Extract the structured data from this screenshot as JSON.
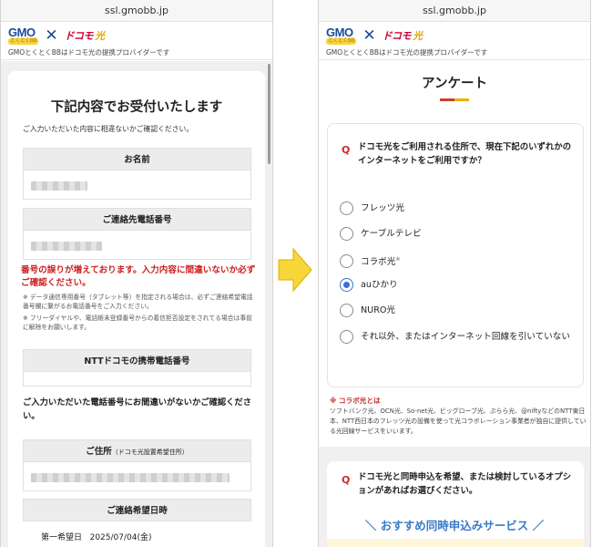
{
  "left": {
    "url": "ssl.gmobb.jp",
    "header": {
      "brand": "GMO",
      "brand_sub": "とくとくBB",
      "times": "✕",
      "partner": "ドコモ",
      "partner_suffix": "光",
      "tagline": "GMOとくとくBBはドコモ光の提携プロバイダーです"
    },
    "title": "下記内容でお受付いたします",
    "subtitle": "ご入力いただいた内容に相違ないかご確認ください。",
    "name_label": "お名前",
    "phone_label": "ご連絡先電話番号",
    "warning": "番号の誤りが増えております。入力内容に間違いないか必ずご確認ください。",
    "note1": "※ データ通信専用番号（タブレット等）を指定される場合は、必ずご連絡希望電話番号欄に繋がるお電話番号をご入力ください。",
    "note2": "※ フリーダイヤルや、電話帳未登録番号からの着信拒否設定をされてる場合は事前に解除をお願いします。",
    "docomo_phone_label": "NTTドコモの携帯電話番号",
    "confirm_text": "ご入力いただいた電話番号にお間違いがないかご確認ください。",
    "address_label": "ご住所",
    "address_sublabel": "（ドコモ光設置希望住所）",
    "date_label": "ご連絡希望日時",
    "date_first_label": "第一希望日",
    "date_first_value": "2025/07/04(金)"
  },
  "right": {
    "url": "ssl.gmobb.jp",
    "header": {
      "brand": "GMO",
      "brand_sub": "とくとくBB",
      "times": "✕",
      "partner": "ドコモ",
      "partner_suffix": "光",
      "tagline": "GMOとくとくBBはドコモ光の提携プロバイダーです"
    },
    "title": "アンケート",
    "q_mark": "Q",
    "question1": "ドコモ光をご利用される住所で、現在下記のいずれかのインターネットをご利用ですか？",
    "options": [
      {
        "label": "フレッツ光",
        "selected": false
      },
      {
        "label": "ケーブルテレビ",
        "selected": false
      },
      {
        "label": "コラボ光",
        "selected": false
      },
      {
        "label": "auひかり",
        "selected": true
      },
      {
        "label": "NURO光",
        "selected": false
      },
      {
        "label": "それ以外、またはインターネット回線を引いていない",
        "selected": false
      }
    ],
    "collab_sup": "※",
    "footnote_title": "※ コラボ光とは",
    "footnote_text": "ソフトバンク光、OCN光、So-net光、ビッグローブ光、ぷらら光、@niftyなどのNTT東日本、NTT西日本のフレッツ光の設備を使って光コラボレーション事業者が独自に提供している光回線サービスをいいます。",
    "question2": "ドコモ光と同時申込を希望、または検討しているオプションがあればお選びください。",
    "recommend_title": "＼ おすすめ同時申込みサービス ／"
  },
  "colors": {
    "accent_red": "#cc1f1f",
    "accent_blue": "#3a7bc8",
    "arrow_yellow": "#f7d63a",
    "radio_selected": "#3f6fd0"
  },
  "icons": {
    "transition": "right-arrow-icon",
    "radio": "radio-icon"
  }
}
